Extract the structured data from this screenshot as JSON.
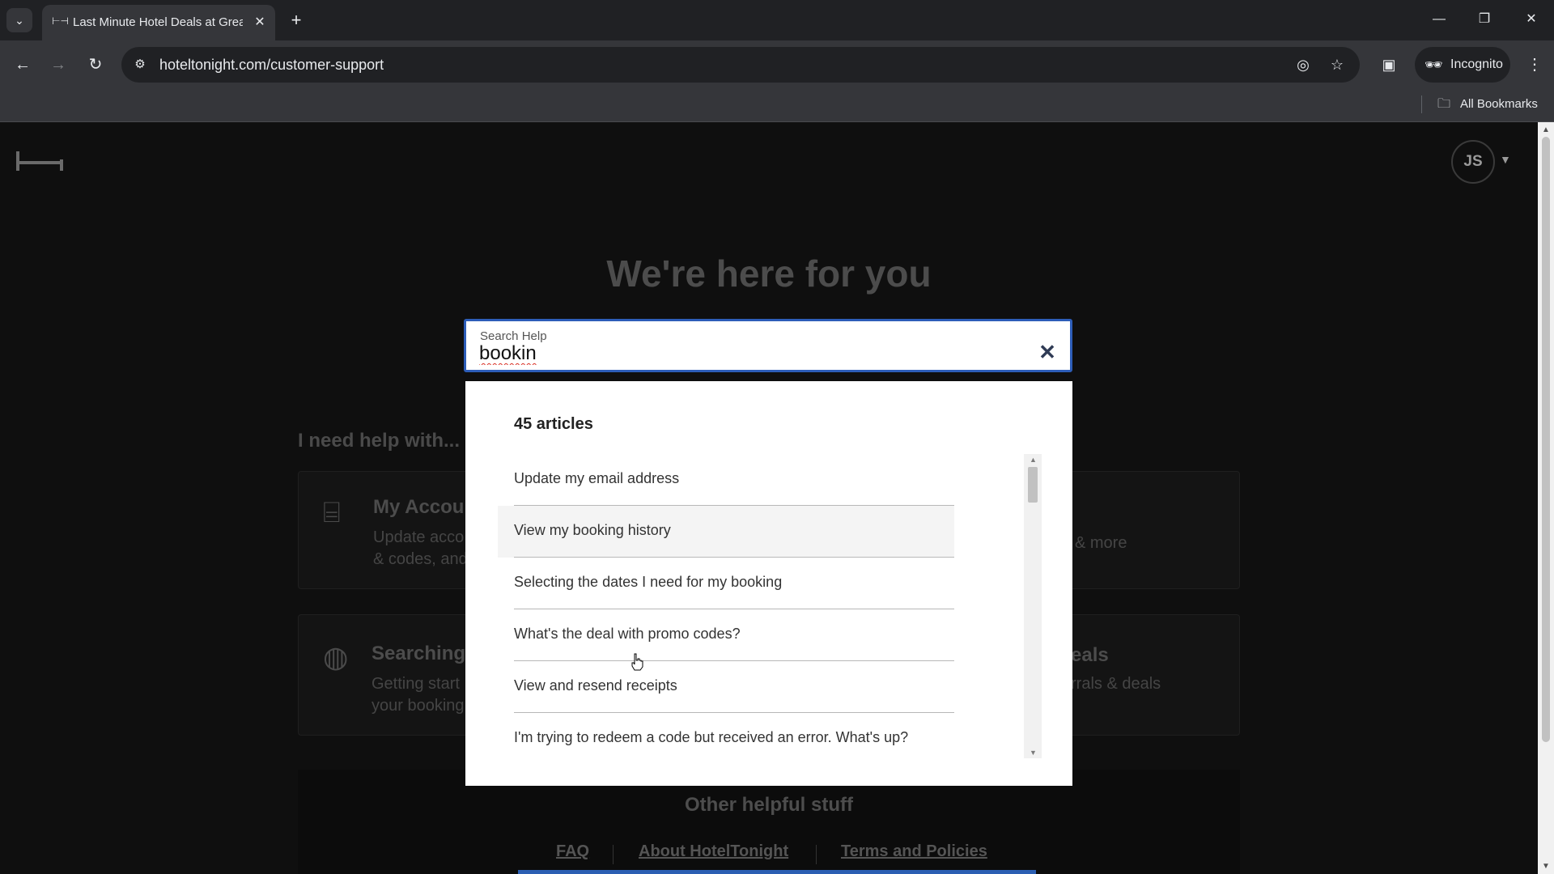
{
  "browser": {
    "tab_title": "Last Minute Hotel Deals at Great Prices",
    "url": "hoteltonight.com/customer-support",
    "incognito_label": "Incognito",
    "bookmarks_label": "All Bookmarks"
  },
  "header": {
    "avatar_initials": "JS"
  },
  "hero": {
    "title": "We're here for you"
  },
  "search": {
    "label": "Search Help",
    "value": "bookin",
    "results_count": "45 articles",
    "results": [
      "Update my email address",
      "View my booking history",
      "Selecting the dates I need for my booking",
      "What's the deal with promo codes?",
      "View and resend receipts",
      "I'm trying to redeem a code but received an error. What's up?"
    ]
  },
  "help": {
    "section_label": "I need help with...",
    "cards": [
      {
        "title": "My Accou",
        "desc_line1": "Update acco",
        "desc_line2": "& codes, and"
      },
      {
        "title": "",
        "desc_line1": "& more",
        "desc_line2": ""
      },
      {
        "title": "Searching",
        "desc_line1": "Getting start",
        "desc_line2": "your booking"
      },
      {
        "title": "eals",
        "desc_line1": "rrals & deals",
        "desc_line2": ""
      }
    ]
  },
  "footer": {
    "title": "Other helpful stuff",
    "links": [
      "FAQ",
      "About HotelTonight",
      "Terms and Policies"
    ]
  }
}
